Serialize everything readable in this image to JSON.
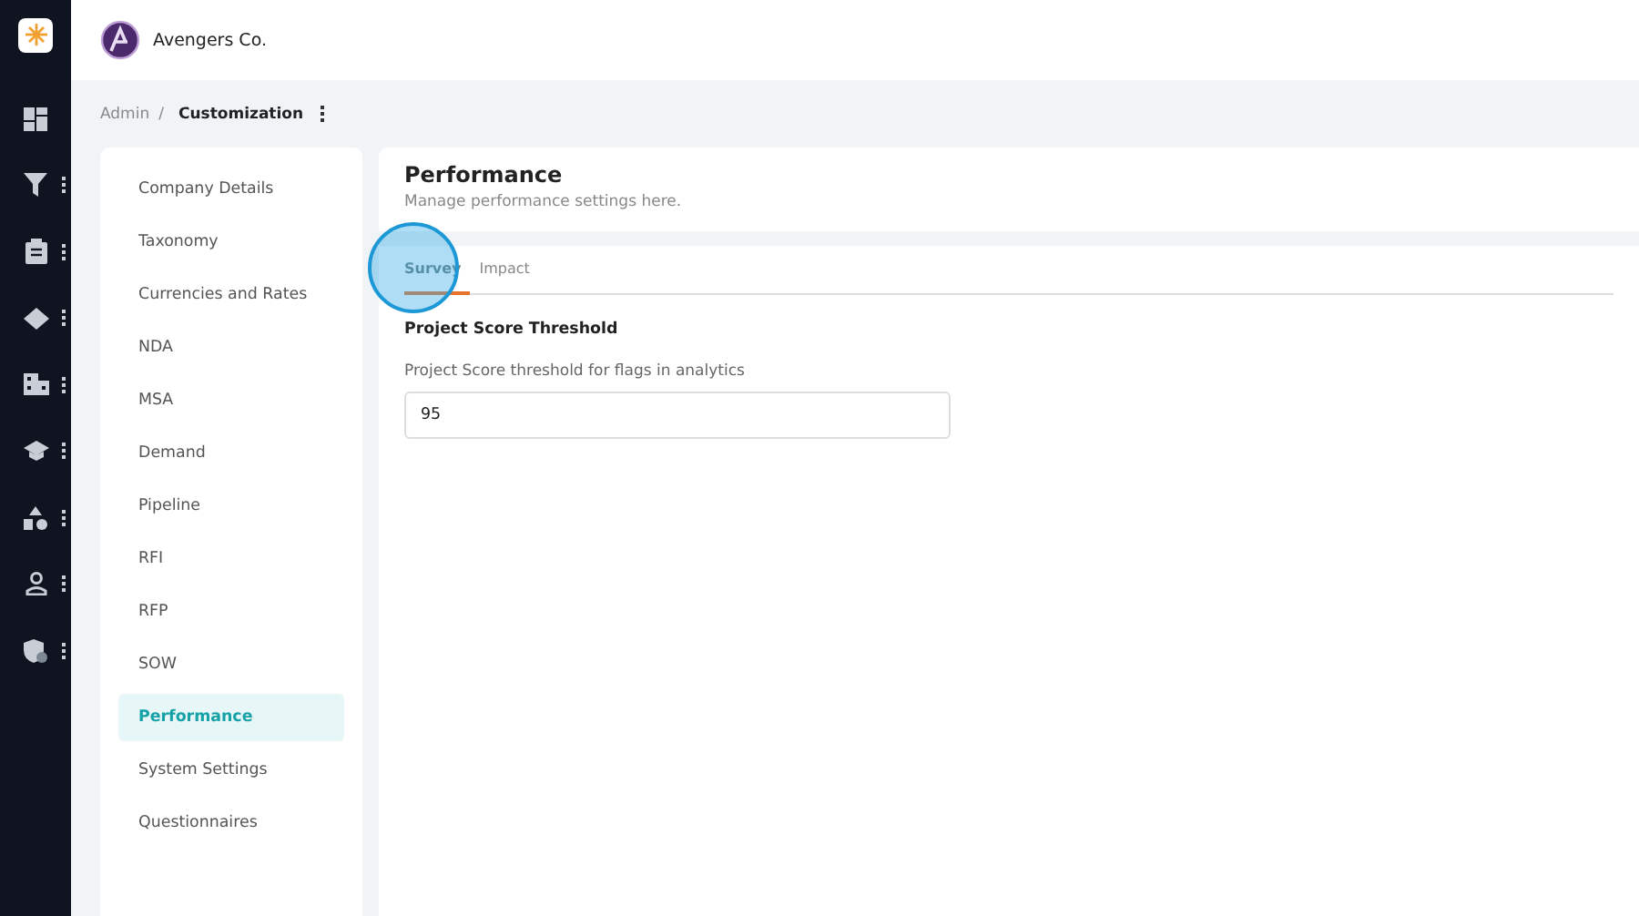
{
  "rail": [
    {
      "kind": "logo"
    },
    {
      "kind": "dashboard",
      "menu": false
    },
    {
      "kind": "filter",
      "menu": true
    },
    {
      "kind": "clipboard",
      "menu": true
    },
    {
      "kind": "tag",
      "menu": true
    },
    {
      "kind": "building",
      "menu": true
    },
    {
      "kind": "cap",
      "menu": true
    },
    {
      "kind": "shapes",
      "menu": true
    },
    {
      "kind": "person",
      "menu": true
    },
    {
      "kind": "shield",
      "menu": true
    }
  ],
  "header": {
    "company": "Avengers Co."
  },
  "breadcrumb": {
    "parent": "Admin",
    "separator": "/",
    "current": "Customization"
  },
  "nav": [
    {
      "label": "Company Details",
      "selected": false
    },
    {
      "label": "Taxonomy",
      "selected": false
    },
    {
      "label": "Currencies and Rates",
      "selected": false
    },
    {
      "label": "NDA",
      "selected": false
    },
    {
      "label": "MSA",
      "selected": false
    },
    {
      "label": "Demand",
      "selected": false
    },
    {
      "label": "Pipeline",
      "selected": false
    },
    {
      "label": "RFI",
      "selected": false
    },
    {
      "label": "RFP",
      "selected": false
    },
    {
      "label": "SOW",
      "selected": false
    },
    {
      "label": "Performance",
      "selected": true
    },
    {
      "label": "System Settings",
      "selected": false
    },
    {
      "label": "Questionnaires",
      "selected": false
    }
  ],
  "page": {
    "title": "Performance",
    "subtitle": "Manage performance settings here."
  },
  "tabs": [
    {
      "label": "Survey",
      "selected": true
    },
    {
      "label": "Impact",
      "selected": false
    }
  ],
  "section": {
    "title": "Project Score Threshold",
    "field_label": "Project Score threshold for flags in analytics",
    "value": "95"
  },
  "click_indicator": true
}
